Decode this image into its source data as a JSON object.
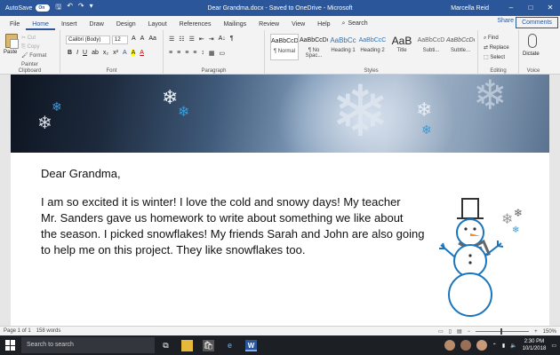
{
  "titlebar": {
    "autosave_label": "AutoSave",
    "autosave_state": "On",
    "title": "Dear Grandma.docx  -  Saved to OneDrive  -  Microsoft",
    "user": "Marcella Reid",
    "minimize": "–",
    "maximize": "□",
    "close": "✕",
    "qat_save": "🖫",
    "qat_undo": "↶",
    "qat_redo": "↷",
    "qat_more": "▾"
  },
  "ribbon_tabs": [
    "File",
    "Home",
    "Insert",
    "Draw",
    "Design",
    "Layout",
    "References",
    "Mailings",
    "Review",
    "View",
    "Help"
  ],
  "search_label": "Search",
  "share_label": "Share",
  "comments_label": "Comments",
  "clipboard": {
    "paste": "Paste",
    "cut": "Cut",
    "copy": "Copy",
    "format_painter": "Format Painter",
    "group": "Clipboard"
  },
  "font": {
    "family": "Calibri (Body)",
    "size": "12",
    "row1": [
      "A",
      "A",
      "Aa",
      "A"
    ],
    "row2": [
      "B",
      "I",
      "U",
      "ab",
      "x₂",
      "x²",
      "A",
      "A",
      "A"
    ],
    "group": "Font"
  },
  "paragraph": {
    "row1": [
      "☰",
      "☷",
      "☰",
      "⇤",
      "⇥",
      "A↓",
      "¶"
    ],
    "row2": [
      "≡",
      "≡",
      "≡",
      "≡",
      "↕",
      "▦",
      "▭"
    ],
    "group": "Paragraph"
  },
  "styles": {
    "items": [
      {
        "sample": "AaBbCcDc",
        "name": "¶ Normal"
      },
      {
        "sample": "AaBbCcDc",
        "name": "¶ No Spac..."
      },
      {
        "sample": "AaBbCc",
        "name": "Heading 1"
      },
      {
        "sample": "AaBbCcC",
        "name": "Heading 2"
      },
      {
        "sample": "AaB",
        "name": "Title"
      },
      {
        "sample": "AaBbCcD",
        "name": "Subti..."
      },
      {
        "sample": "AaBbCcDc",
        "name": "Subtle..."
      }
    ],
    "group": "Styles"
  },
  "editing": {
    "find": "Find",
    "replace": "Replace",
    "select": "Select",
    "group": "Editing"
  },
  "voice": {
    "dictate": "Dictate",
    "group": "Voice"
  },
  "document": {
    "greeting": "Dear Grandma,",
    "lines": [
      "I am so excited it is winter! I love the cold and snowy days! My teacher",
      "Mr. Sanders gave us homework to write about something we like about",
      "the season. I picked snowflakes! My friends Sarah and John are also going",
      "to help me on this project. They like snowflakes too."
    ]
  },
  "statusbar": {
    "page": "Page 1 of 1",
    "words": "158 words",
    "zoom": "150%"
  },
  "taskbar": {
    "search_placeholder": "Search to search",
    "time": "2:30 PM",
    "date": "10/1/2018"
  },
  "colors": {
    "word_blue": "#2b579a",
    "ribbon_bg": "#f3f3f3",
    "taskbar_bg": "#1c1f24"
  }
}
